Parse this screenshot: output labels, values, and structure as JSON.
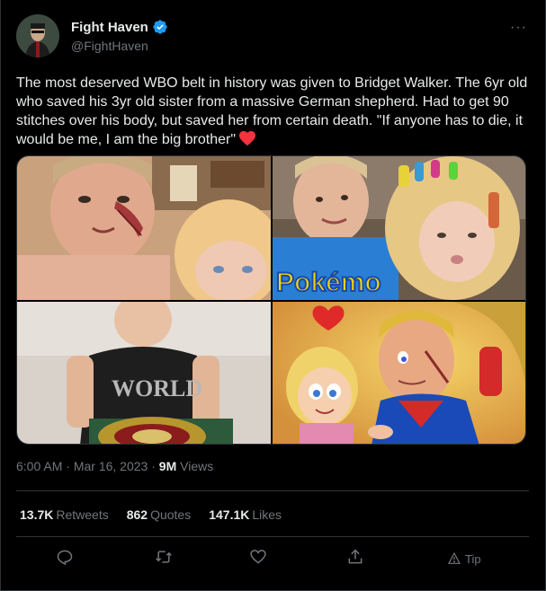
{
  "author": {
    "display_name": "Fight Haven",
    "handle": "@FightHaven"
  },
  "more_label": "···",
  "tweet": {
    "text": "The most deserved WBO belt in history was given to Bridget Walker. The 6yr old who saved his 3yr old sister from a massive German shepherd. Had to get 90 stitches over his body, but saved her from certain death. \"If anyone has to die, it would be me, I am the big brother\""
  },
  "photo_text": {
    "pokemon": "Pokémo",
    "world": "WORLD"
  },
  "meta": {
    "time": "6:00 AM",
    "sep1": "·",
    "date": "Mar 16, 2023",
    "sep2": "·",
    "views_count": "9M",
    "views_label": "Views"
  },
  "stats": {
    "retweets_count": "13.7K",
    "retweets_label": "Retweets",
    "quotes_count": "862",
    "quotes_label": "Quotes",
    "likes_count": "147.1K",
    "likes_label": "Likes"
  },
  "actions": {
    "tip_label": "Tip"
  },
  "colors": {
    "verified": "#1d9bf0",
    "heart": "#f91880",
    "muted": "#71767b",
    "text": "#e7e9ea",
    "border": "#2f3336"
  }
}
